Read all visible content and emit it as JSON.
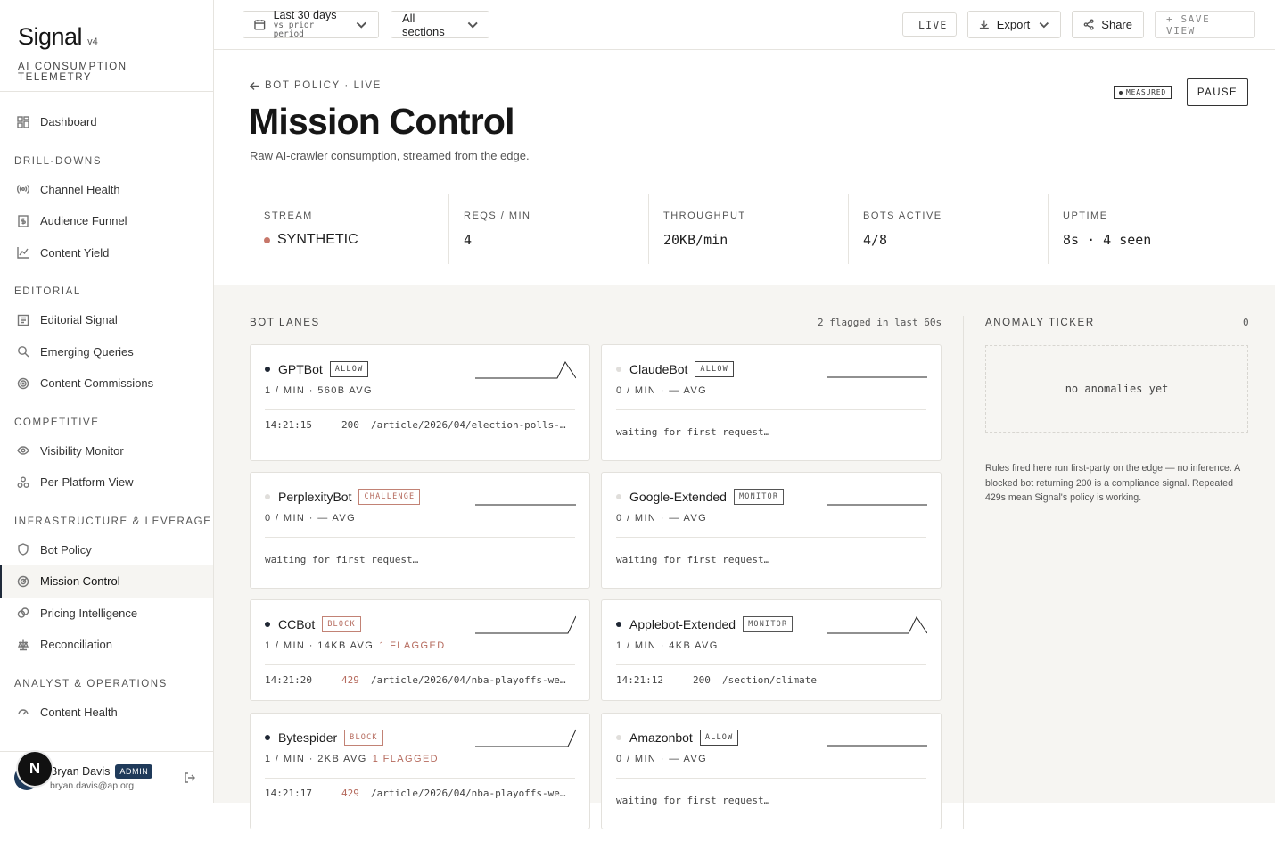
{
  "brand": {
    "name": "Signal",
    "version": "v4",
    "subtitle": "AI CONSUMPTION TELEMETRY"
  },
  "sidebar": {
    "top_item": {
      "label": "Dashboard",
      "icon": "dashboard-icon"
    },
    "sections": [
      {
        "title": "DRILL-DOWNS",
        "items": [
          {
            "label": "Channel Health",
            "icon": "broadcast-icon"
          },
          {
            "label": "Audience Funnel",
            "icon": "dollar-doc-icon"
          },
          {
            "label": "Content Yield",
            "icon": "line-chart-icon"
          }
        ]
      },
      {
        "title": "EDITORIAL",
        "items": [
          {
            "label": "Editorial Signal",
            "icon": "newspaper-icon"
          },
          {
            "label": "Emerging Queries",
            "icon": "search-icon"
          },
          {
            "label": "Content Commissions",
            "icon": "target-icon"
          }
        ]
      },
      {
        "title": "COMPETITIVE",
        "items": [
          {
            "label": "Visibility Monitor",
            "icon": "eye-icon"
          },
          {
            "label": "Per-Platform View",
            "icon": "platforms-icon"
          }
        ]
      },
      {
        "title": "INFRASTRUCTURE & LEVERAGE",
        "items": [
          {
            "label": "Bot Policy",
            "icon": "shield-icon"
          },
          {
            "label": "Mission Control",
            "icon": "radar-icon",
            "active": true
          },
          {
            "label": "Pricing Intelligence",
            "icon": "coins-icon"
          },
          {
            "label": "Reconciliation",
            "icon": "scale-icon"
          }
        ]
      },
      {
        "title": "ANALYST & OPERATIONS",
        "items": [
          {
            "label": "Content Health",
            "icon": "gauge-icon"
          }
        ]
      }
    ]
  },
  "user": {
    "name": "Bryan Davis",
    "role": "ADMIN",
    "email": "bryan.davis@ap.org",
    "initial": "N"
  },
  "topbar": {
    "range_main": "Last 30 days",
    "range_sub": "vs prior period",
    "sections": "All sections",
    "live": "LIVE",
    "export": "Export",
    "share": "Share",
    "save_view": "+ SAVE VIEW"
  },
  "header": {
    "breadcrumb": "BOT POLICY · LIVE",
    "title": "Mission Control",
    "subtitle": "Raw AI-crawler consumption, streamed from the edge.",
    "measured": "MEASURED",
    "pause": "PAUSE"
  },
  "stats": [
    {
      "label": "STREAM",
      "value": "SYNTHETIC",
      "dot": "#c7776a"
    },
    {
      "label": "REQS / MIN",
      "value": "4"
    },
    {
      "label": "THROUGHPUT",
      "value": "20KB/min"
    },
    {
      "label": "BOTS ACTIVE",
      "value": "4/8"
    },
    {
      "label": "UPTIME",
      "value": "8s · 4 seen"
    }
  ],
  "lanes": {
    "title": "BOT LANES",
    "flagged_summary": "2 flagged in last 60s",
    "bots": [
      {
        "name": "GPTBot",
        "policy": "ALLOW",
        "active": true,
        "meta": "1 / MIN · 560B AVG",
        "flagged": "",
        "time": "14:21:15",
        "status": "200",
        "path": "/article/2026/04/election-polls-s…",
        "waiting": ""
      },
      {
        "name": "ClaudeBot",
        "policy": "ALLOW",
        "active": false,
        "meta": "0 / MIN · — AVG",
        "flagged": "",
        "time": "",
        "status": "",
        "path": "",
        "waiting": "waiting for first request…"
      },
      {
        "name": "PerplexityBot",
        "policy": "CHALLENGE",
        "active": false,
        "meta": "0 / MIN · — AVG",
        "flagged": "",
        "time": "",
        "status": "",
        "path": "",
        "waiting": "waiting for first request…"
      },
      {
        "name": "Google-Extended",
        "policy": "MONITOR",
        "active": false,
        "meta": "0 / MIN · — AVG",
        "flagged": "",
        "time": "",
        "status": "",
        "path": "",
        "waiting": "waiting for first request…"
      },
      {
        "name": "CCBot",
        "policy": "BLOCK",
        "active": true,
        "meta": "1 / MIN · 14KB AVG",
        "flagged": "1 FLAGGED",
        "time": "14:21:20",
        "status": "429",
        "path": "/article/2026/04/nba-playoffs-wes…",
        "waiting": ""
      },
      {
        "name": "Applebot-Extended",
        "policy": "MONITOR",
        "active": true,
        "meta": "1 / MIN · 4KB AVG",
        "flagged": "",
        "time": "14:21:12",
        "status": "200",
        "path": "/section/climate",
        "waiting": ""
      },
      {
        "name": "Bytespider",
        "policy": "BLOCK",
        "active": true,
        "meta": "1 / MIN · 2KB AVG",
        "flagged": "1 FLAGGED",
        "time": "14:21:17",
        "status": "429",
        "path": "/article/2026/04/nba-playoffs-wes…",
        "waiting": ""
      },
      {
        "name": "Amazonbot",
        "policy": "ALLOW",
        "active": false,
        "meta": "0 / MIN · — AVG",
        "flagged": "",
        "time": "",
        "status": "",
        "path": "",
        "waiting": "waiting for first request…"
      }
    ]
  },
  "ticker": {
    "title": "ANOMALY TICKER",
    "count": "0",
    "empty": "no anomalies yet",
    "note": "Rules fired here run first-party on the edge — no inference. A blocked bot returning 200 is a compliance signal. Repeated 429s mean Signal's policy is working."
  }
}
